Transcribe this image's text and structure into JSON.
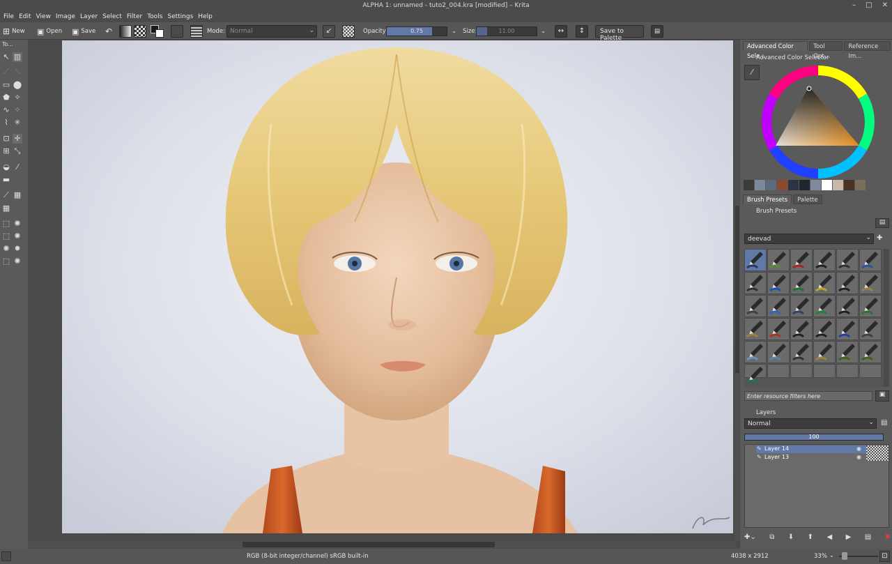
{
  "window": {
    "title": "ALPHA 1: unnamed - tuto2_004.kra [modified] – Krita",
    "controls": [
      "–",
      "□",
      "✕"
    ]
  },
  "menu": [
    "File",
    "Edit",
    "View",
    "Image",
    "Layer",
    "Select",
    "Filter",
    "Tools",
    "Settings",
    "Help"
  ],
  "toolbar": {
    "new_label": "New",
    "open_label": "Open",
    "save_label": "Save",
    "mode_label": "Mode:",
    "mode_value": "Normal",
    "opacity_label": "Opacity:",
    "opacity_value": "0.75",
    "opacity": 0.75,
    "size_label": "Size:",
    "size_value": "11.00",
    "save_palette_label": "Save to Palette"
  },
  "toolbox": {
    "title": "To..."
  },
  "dockers": {
    "top_tabs": [
      "Advanced Color Sele...",
      "Tool Opt...",
      "Reference Im..."
    ],
    "color_selector_title": "Advanced Color Selector",
    "swatch_colors": [
      "#3b3b3b",
      "#7a8a9a",
      "#5c6b7c",
      "#8a4a2c",
      "#2c3444",
      "#1e2630",
      "#7c8c9c",
      "#ffffff",
      "#c8b8a8",
      "#4a3224",
      "#7c6c5c",
      "#5a5a5a"
    ],
    "mid_tabs": [
      "Brush Presets",
      "Palette"
    ],
    "brush_presets_title": "Brush Presets",
    "brush_tag": "deevad",
    "filter_placeholder": "Enter resource filters here",
    "layers_title": "Layers",
    "blend_mode": "Normal",
    "layer_opacity": "100",
    "layers": [
      {
        "name": "Layer 14",
        "selected": true
      },
      {
        "name": "Layer 13",
        "selected": false
      }
    ]
  },
  "status": {
    "color_info": "RGB (8-bit integer/channel)  sRGB built-in",
    "dimensions": "4038 x 2912",
    "zoom": "33%"
  },
  "colors": {
    "accent": "#6179a6",
    "panel": "#5a5a5a",
    "dark": "#3c3c3c"
  }
}
